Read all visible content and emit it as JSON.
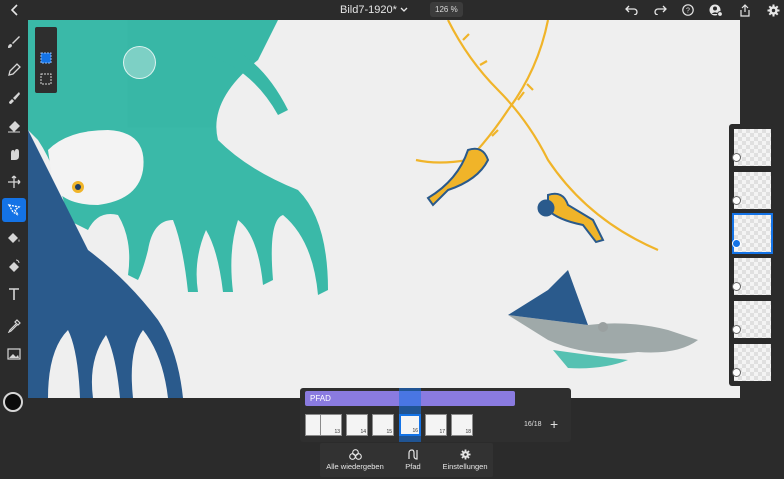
{
  "document": {
    "title": "Bild7-1920*",
    "zoom": "126 %"
  },
  "topbar": {
    "left_icon": "chevron-left-icon",
    "right_icons": [
      "undo-icon",
      "redo-icon",
      "help-icon",
      "account-icon",
      "share-icon",
      "settings-icon"
    ]
  },
  "toolbar": {
    "tools": [
      "brush-icon",
      "pen-icon",
      "paint-icon",
      "eraser-icon",
      "smudge-icon",
      "transform-icon",
      "lasso-icon",
      "fill-icon",
      "liquify-icon",
      "text-icon",
      "eyedropper-icon",
      "image-icon"
    ],
    "active_tool": "lasso-icon",
    "color": "#0b0b0b"
  },
  "layers": {
    "count": 6,
    "selected_index": 2
  },
  "timeline": {
    "path_label": "PFAD",
    "frames": [
      "12",
      "13",
      "14",
      "15",
      "16",
      "17",
      "18"
    ],
    "selected_frame": "16",
    "counter": "16/18",
    "add_label": "+"
  },
  "bottombar": {
    "play_all": "Alle wiedergeben",
    "path": "Pfad",
    "settings": "Einstellungen"
  },
  "colors": {
    "accent": "#1473e6",
    "teal": "#2fb5a3",
    "navy": "#2a5a8c",
    "yellow": "#f0b429",
    "path_bar": "#8a7be0"
  }
}
